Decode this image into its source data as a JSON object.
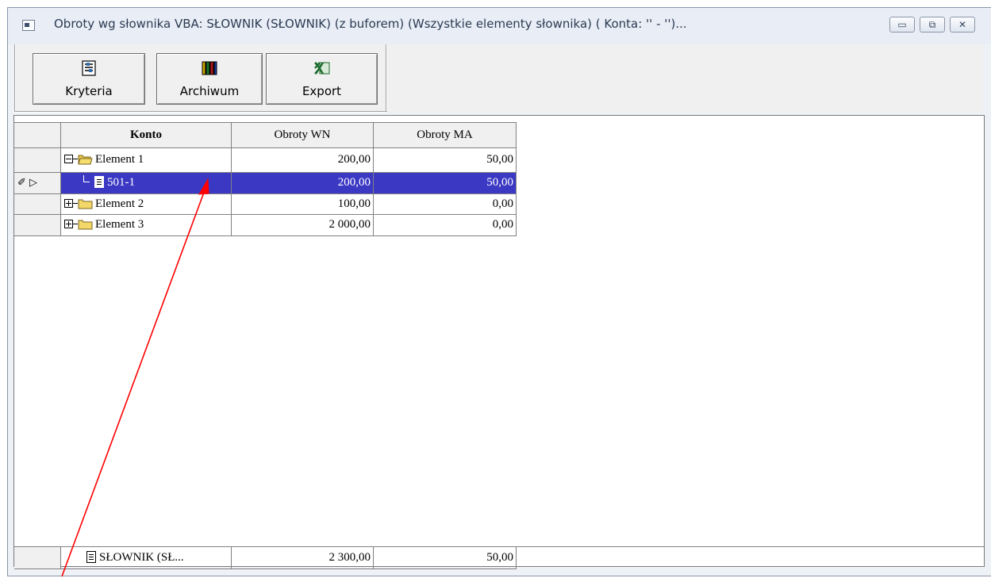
{
  "window": {
    "title": "Obroty wg słownika VBA: SŁOWNIK (SŁOWNIK)  (z buforem)  (Wszystkie elementy słownika)  ( Konta: '' - '')...",
    "controls": {
      "minimize": "▭",
      "restore": "⧉",
      "close": "✕"
    }
  },
  "toolbar": {
    "buttons": [
      {
        "label": "Kryteria",
        "icon": "criteria-icon"
      },
      {
        "label": "Archiwum",
        "icon": "books-icon"
      },
      {
        "label": "Export",
        "icon": "excel-icon"
      }
    ]
  },
  "grid": {
    "columns": [
      "Konto",
      "Obroty WN",
      "Obroty MA"
    ],
    "rows": [
      {
        "konto": "Element 1",
        "wn": "200,00",
        "ma": "50,00",
        "level": 0,
        "expanded": true,
        "selected": false
      },
      {
        "konto": "501-1",
        "wn": "200,00",
        "ma": "50,00",
        "level": 1,
        "expanded": null,
        "selected": true
      },
      {
        "konto": "Element 2",
        "wn": "100,00",
        "ma": "0,00",
        "level": 0,
        "expanded": false,
        "selected": false
      },
      {
        "konto": "Element 3",
        "wn": "2 000,00",
        "ma": "0,00",
        "level": 0,
        "expanded": false,
        "selected": false
      }
    ],
    "footer": {
      "konto": "SŁOWNIK (SŁ...",
      "wn": "2 300,00",
      "ma": "50,00"
    },
    "row_indicator": "✐ ▷"
  },
  "colors": {
    "selection": "#3b38c4",
    "annotation_arrow": "#ff0000"
  }
}
